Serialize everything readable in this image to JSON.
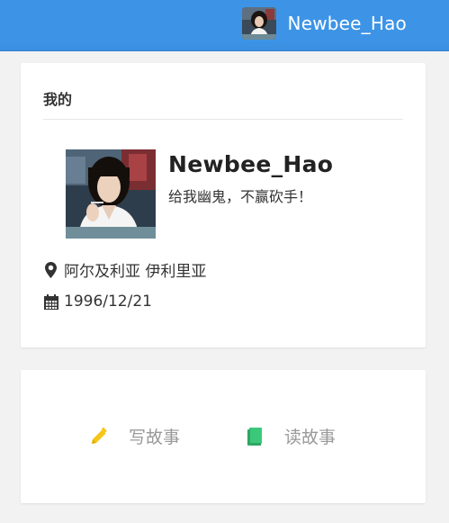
{
  "header": {
    "username": "Newbee_Hao",
    "avatar_icon": "user-avatar",
    "bar_color": "#3d94e6"
  },
  "profile_card": {
    "title": "我的",
    "name": "Newbee_Hao",
    "motto": "给我幽鬼，不赢砍手！",
    "location": "阿尔及利亚 伊利里亚",
    "location_icon": "map-marker-icon",
    "birthday": "1996/12/21",
    "birthday_icon": "calendar-icon"
  },
  "actions": {
    "write_label": "写故事",
    "write_icon": "pencil-icon",
    "write_icon_color": "#f5c518",
    "read_label": "读故事",
    "read_icon": "book-icon",
    "read_icon_color": "#3cc87a"
  }
}
